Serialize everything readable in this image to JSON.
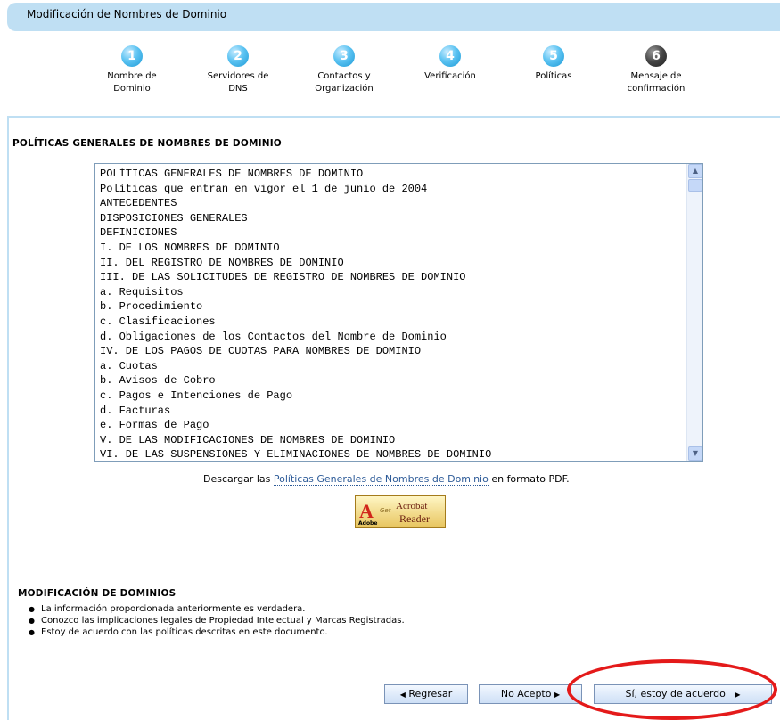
{
  "header": {
    "title": "Modificación de Nombres de Dominio"
  },
  "steps": [
    {
      "number": "1",
      "label_line1": "Nombre de",
      "label_line2": "Dominio"
    },
    {
      "number": "2",
      "label_line1": "Servidores de DNS",
      "label_line2": ""
    },
    {
      "number": "3",
      "label_line1": "Contactos y",
      "label_line2": "Organización"
    },
    {
      "number": "4",
      "label_line1": "Verificación",
      "label_line2": ""
    },
    {
      "number": "5",
      "label_line1": "Políticas",
      "label_line2": ""
    },
    {
      "number": "6",
      "label_line1": "Mensaje de",
      "label_line2": "confirmación"
    }
  ],
  "policies": {
    "section_title": "POLÍTICAS GENERALES DE NOMBRES DE DOMINIO",
    "text": "POLÍTICAS GENERALES DE NOMBRES DE DOMINIO\nPolíticas que entran en vigor el 1 de junio de 2004\nANTECEDENTES\nDISPOSICIONES GENERALES\nDEFINICIONES\nI. DE LOS NOMBRES DE DOMINIO\nII. DEL REGISTRO DE NOMBRES DE DOMINIO\nIII. DE LAS SOLICITUDES DE REGISTRO DE NOMBRES DE DOMINIO\na. Requisitos\nb. Procedimiento\nc. Clasificaciones\nd. Obligaciones de los Contactos del Nombre de Dominio\nIV. DE LOS PAGOS DE CUOTAS PARA NOMBRES DE DOMINIO\na. Cuotas\nb. Avisos de Cobro\nc. Pagos e Intenciones de Pago\nd. Facturas\ne. Formas de Pago\nV. DE LAS MODIFICACIONES DE NOMBRES DE DOMINIO\nVI. DE LAS SUSPENSIONES Y ELIMINACIONES DE NOMBRES DE DOMINIO"
  },
  "download": {
    "prefix": "Descargar las",
    "link": "Políticas Generales de Nombres de Dominio",
    "suffix": "en formato PDF."
  },
  "acrobat_badge": {
    "brand": "Adobe",
    "get": "Get",
    "name_line1": "Acrobat",
    "name_line2": "Reader"
  },
  "modification": {
    "section_title": "MODIFICACIÓN DE DOMINIOS",
    "items": [
      "La información proporcionada anteriormente es verdadera.",
      "Conozco las implicaciones legales de Propiedad Intelectual y Marcas Registradas.",
      "Estoy de acuerdo con las políticas descritas en este documento."
    ]
  },
  "buttons": {
    "back": "Regresar",
    "decline": "No Acepto",
    "accept": "Sí, estoy de acuerdo"
  },
  "colors": {
    "header_bg": "#bfdff3",
    "step_blue": "#1d9ad6",
    "highlight": "#e41a1a"
  }
}
